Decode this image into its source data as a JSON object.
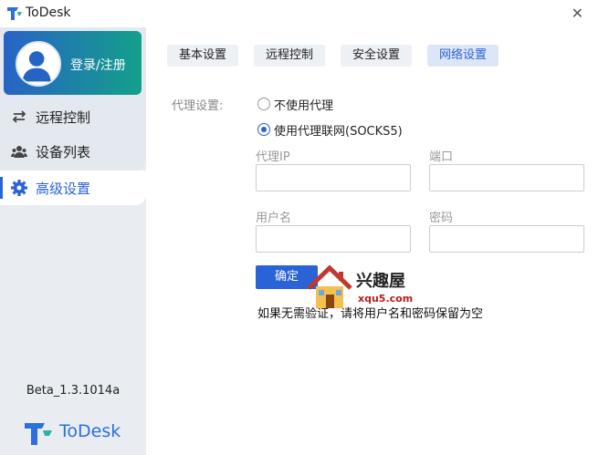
{
  "window": {
    "title": "ToDesk",
    "close_glyph": "✕"
  },
  "sidebar": {
    "login_label": "登录/注册",
    "items": [
      {
        "label": "远程控制",
        "icon": "swap-arrows-icon"
      },
      {
        "label": "设备列表",
        "icon": "users-icon"
      },
      {
        "label": "高级设置",
        "icon": "gear-icon",
        "active": true
      }
    ],
    "version": "Beta_1.3.1014a",
    "brand": "ToDesk"
  },
  "tabs": [
    {
      "label": "基本设置",
      "active": false
    },
    {
      "label": "远程控制",
      "active": false
    },
    {
      "label": "安全设置",
      "active": false
    },
    {
      "label": "网络设置",
      "active": true
    }
  ],
  "proxy": {
    "label": "代理设置:",
    "options": [
      {
        "label": "不使用代理",
        "checked": false
      },
      {
        "label": "使用代理联网(SOCKS5)",
        "checked": true
      }
    ],
    "fields": {
      "ip_label": "代理IP",
      "ip_value": "",
      "port_label": "端口",
      "port_value": "",
      "user_label": "用户名",
      "user_value": "",
      "password_label": "密码",
      "password_value": ""
    },
    "confirm_label": "确定",
    "hint": "如果无需验证，请将用户名和密码保留为空"
  },
  "watermark": {
    "text": "兴趣屋",
    "site": "xqu5.com"
  },
  "colors": {
    "accent": "#2a62d8",
    "gradient_start": "#2763c6",
    "gradient_end": "#14a08a"
  }
}
